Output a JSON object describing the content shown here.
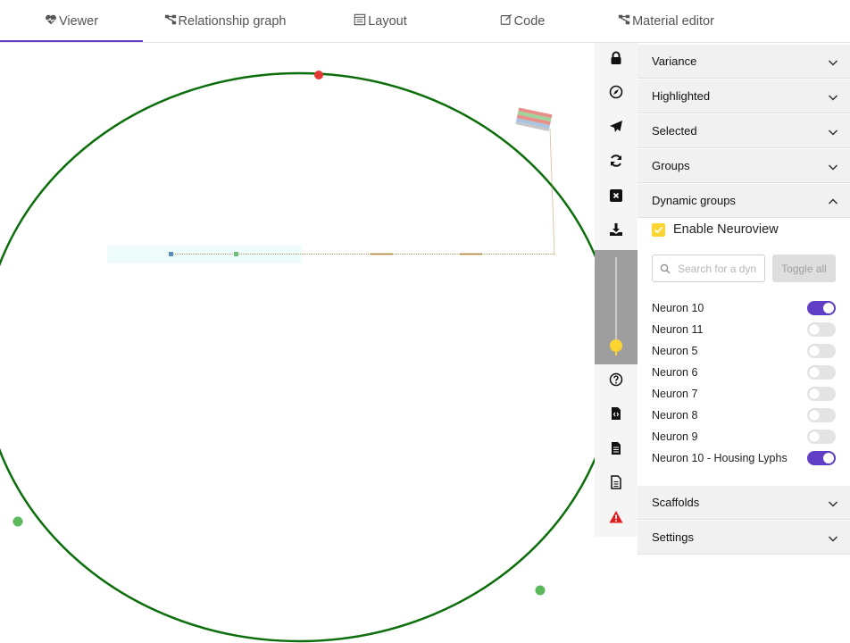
{
  "tabs": [
    {
      "label": "Viewer",
      "icon": "heartbeat-icon",
      "active": true
    },
    {
      "label": "Relationship graph",
      "icon": "graph-icon",
      "active": false
    },
    {
      "label": "Layout",
      "icon": "layout-icon",
      "active": false
    },
    {
      "label": "Code",
      "icon": "edit-icon",
      "active": false
    },
    {
      "label": "Material editor",
      "icon": "graph-icon",
      "active": false
    }
  ],
  "colors": {
    "accent": "#613ec6",
    "highlight_yellow": "#fcd533",
    "lyph_green": "#0b6e0b",
    "node_red": "#e53935",
    "node_green": "#5cb85c"
  },
  "toolbar": {
    "tools": [
      {
        "name": "lock-icon"
      },
      {
        "name": "compass-icon"
      },
      {
        "name": "paper-plane-icon"
      },
      {
        "name": "refresh-icon"
      },
      {
        "name": "close-square-icon"
      },
      {
        "name": "download-icon"
      },
      {
        "name": "question-circle-icon"
      },
      {
        "name": "file-code-icon"
      },
      {
        "name": "file-text-icon"
      },
      {
        "name": "file-alt-icon"
      },
      {
        "name": "warning-icon"
      }
    ],
    "zoom_slider": {
      "value_fraction": 0.0
    }
  },
  "panel": {
    "sections_top": [
      {
        "label": "Variance",
        "expanded": false
      },
      {
        "label": "Highlighted",
        "expanded": false
      },
      {
        "label": "Selected",
        "expanded": false
      },
      {
        "label": "Groups",
        "expanded": false
      },
      {
        "label": "Dynamic groups",
        "expanded": true
      }
    ],
    "dynamic_groups": {
      "enable_neuroview_label": "Enable Neuroview",
      "enable_neuroview_checked": true,
      "search_placeholder": "Search for a dyn",
      "toggle_all_label": "Toggle all",
      "neurons": [
        {
          "label": "Neuron 10",
          "on": true
        },
        {
          "label": "Neuron 11",
          "on": false
        },
        {
          "label": "Neuron 5",
          "on": false
        },
        {
          "label": "Neuron 6",
          "on": false
        },
        {
          "label": "Neuron 7",
          "on": false
        },
        {
          "label": "Neuron 8",
          "on": false
        },
        {
          "label": "Neuron 9",
          "on": false
        },
        {
          "label": "Neuron 10 - Housing Lyphs",
          "on": true
        }
      ]
    },
    "sections_bottom": [
      {
        "label": "Scaffolds",
        "expanded": false
      },
      {
        "label": "Settings",
        "expanded": false
      }
    ]
  }
}
